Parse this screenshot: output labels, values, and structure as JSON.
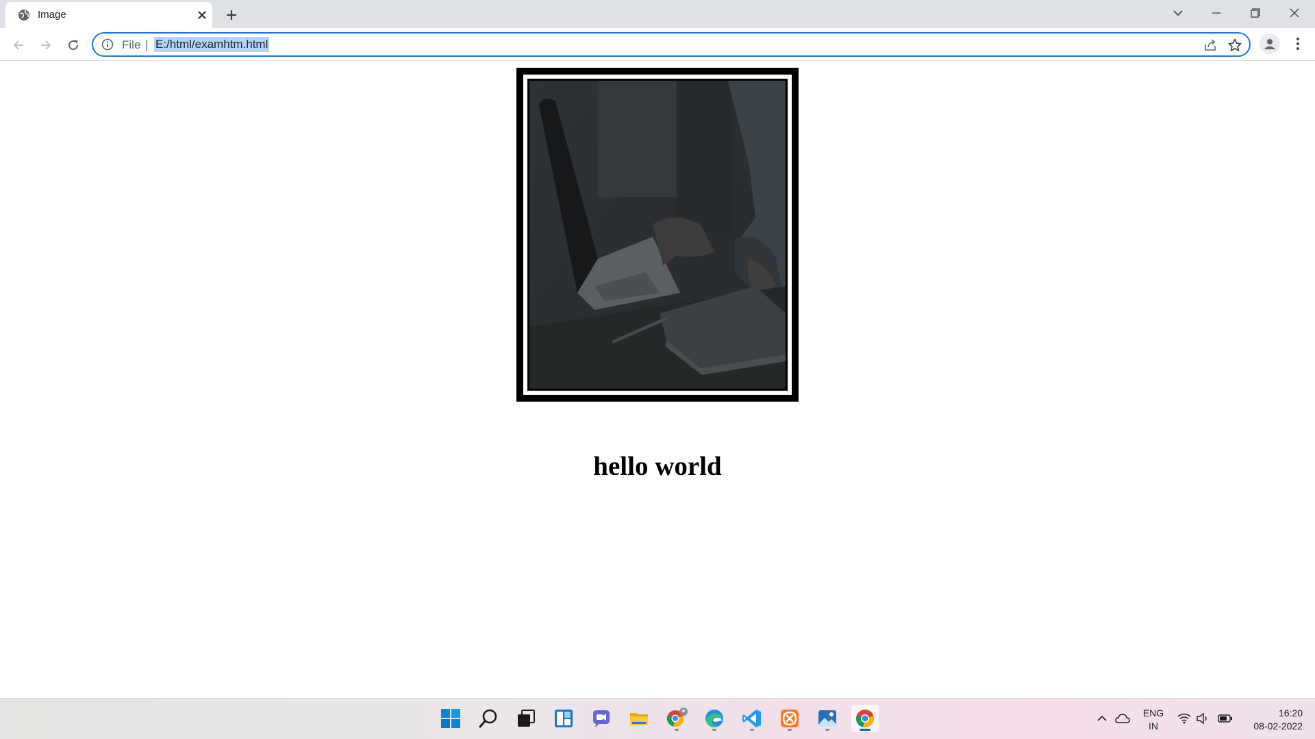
{
  "browser": {
    "tab": {
      "title": "Image",
      "favicon": "globe-icon"
    },
    "omnibox": {
      "scheme_label": "File",
      "separator": "|",
      "url": "E:/html/examhtm.html"
    },
    "colors": {
      "accent": "#1a73e8",
      "tabstrip": "#dee1e6",
      "selection": "#b3d4fc"
    }
  },
  "page": {
    "image": {
      "description_icon": "laptop-photo"
    },
    "heading": "hello world",
    "colors": {
      "frame": "#000000",
      "photo_tone": "#2a2e30"
    }
  },
  "taskbar": {
    "apps": [
      {
        "name": "start",
        "icon": "windows-icon"
      },
      {
        "name": "search",
        "icon": "search-icon"
      },
      {
        "name": "task-view",
        "icon": "task-view-icon"
      },
      {
        "name": "widgets",
        "icon": "widgets-icon"
      },
      {
        "name": "chat",
        "icon": "chat-icon"
      },
      {
        "name": "file-explorer",
        "icon": "folder-icon"
      },
      {
        "name": "chrome-profile",
        "icon": "chrome-icon"
      },
      {
        "name": "edge",
        "icon": "edge-icon"
      },
      {
        "name": "vscode",
        "icon": "vscode-icon"
      },
      {
        "name": "xampp",
        "icon": "xampp-icon"
      },
      {
        "name": "photos",
        "icon": "photos-icon"
      },
      {
        "name": "chrome",
        "icon": "chrome-icon",
        "active": true
      }
    ],
    "tray": {
      "lang_top": "ENG",
      "lang_bottom": "IN",
      "time": "16:20",
      "date": "08-02-2022"
    }
  }
}
